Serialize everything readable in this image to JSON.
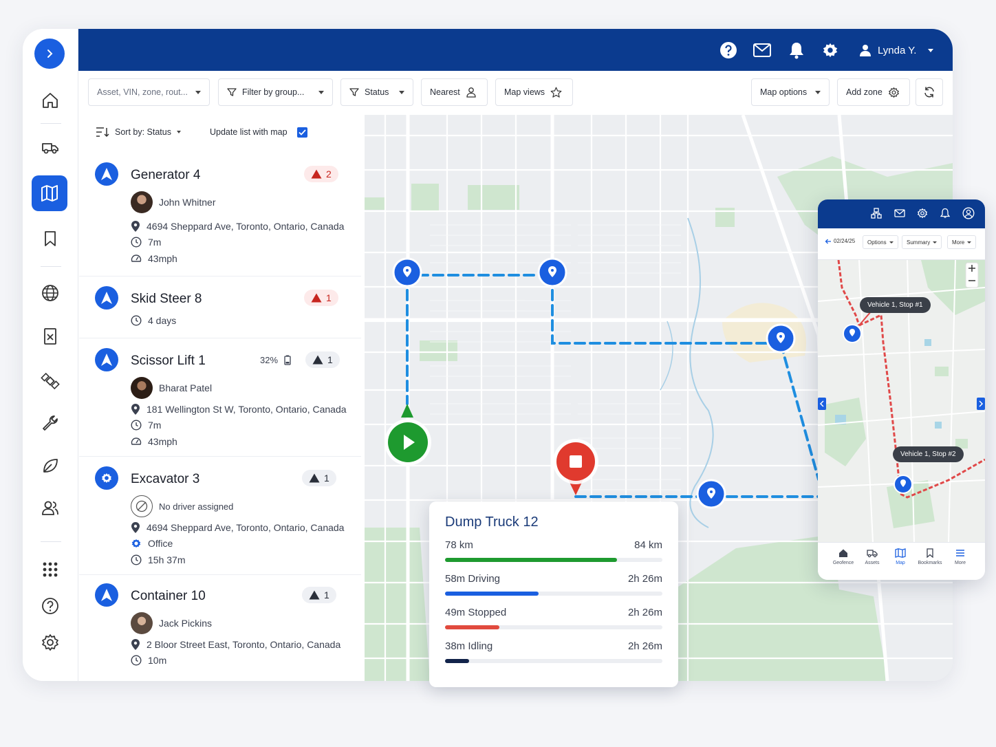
{
  "header": {
    "user_name": "Lynda Y.",
    "icons": [
      "help-icon",
      "mail-icon",
      "bell-icon",
      "gear-icon",
      "user-icon"
    ]
  },
  "sidebar": {
    "items": [
      "home-icon",
      "truck-icon",
      "map-icon",
      "bookmark-icon",
      "globe-icon",
      "report-icon",
      "satellite-icon",
      "wrench-icon",
      "leaf-icon",
      "users-icon",
      "apps-icon",
      "help-icon",
      "settings-icon"
    ],
    "active": "map-icon"
  },
  "filters": {
    "search_placeholder": "Asset, VIN, zone, rout...",
    "group": "Filter by group...",
    "status": "Status",
    "nearest": "Nearest",
    "map_views": "Map views",
    "map_options": "Map options",
    "add_zone": "Add zone"
  },
  "list": {
    "sort_label": "Sort by: Status",
    "update_label": "Update list with map",
    "update_checked": true,
    "assets": [
      {
        "name": "Generator 4",
        "alert": "2",
        "alert_color": "#c7261f",
        "driver": "John Whitner",
        "address": "4694 Sheppard Ave, Toronto, Ontario, Canada",
        "time": "7m",
        "speed": "43mph"
      },
      {
        "name": "Skid Steer 8",
        "alert": "1",
        "alert_color": "#c7261f",
        "time": "4 days"
      },
      {
        "name": "Scissor Lift 1",
        "battery": "32%",
        "alert": "1",
        "driver": "Bharat Patel",
        "address": "181 Wellington St W, Toronto, Ontario, Canada",
        "time": "7m",
        "speed": "43mph"
      },
      {
        "name": "Excavator 3",
        "alert": "1",
        "driver": "No driver assigned",
        "address": "4694 Sheppard Ave, Toronto, Ontario, Canada",
        "zone": "Office",
        "time": "15h 37m"
      },
      {
        "name": "Container 10",
        "alert": "1",
        "driver": "Jack Pickins",
        "address": "2 Bloor Street East, Toronto, Ontario, Canada",
        "time": "10m"
      }
    ]
  },
  "summary": {
    "title": "Dump Truck 12",
    "rows": [
      {
        "left": "78 km",
        "right": "84 km",
        "fraction": 0.79,
        "color": "#1e9a2f"
      },
      {
        "left": "58m Driving",
        "right": "2h 26m",
        "fraction": 0.43,
        "color": "#1a5fe0"
      },
      {
        "left": "49m Stopped",
        "right": "2h 26m",
        "fraction": 0.25,
        "color": "#e14a3e"
      },
      {
        "left": "38m Idling",
        "right": "2h 26m",
        "fraction": 0.11,
        "color": "#12234a"
      }
    ]
  },
  "phone": {
    "date": "02/24/25",
    "options": "Options",
    "summary": "Summary",
    "more": "More",
    "tip1": "Vehicle 1, Stop #1",
    "tip2": "Vehicle 1, Stop #2",
    "nav": [
      "Geofence",
      "Assets",
      "Map",
      "Bookmarks",
      "More"
    ],
    "nav_active": "Map"
  },
  "colors": {
    "brand": "#0b3b8f",
    "accent": "#1a5fe0",
    "route": "#1f8ee0",
    "start": "#1e9a2f",
    "stop": "#e03a2e",
    "phone_route": "#e04848"
  }
}
